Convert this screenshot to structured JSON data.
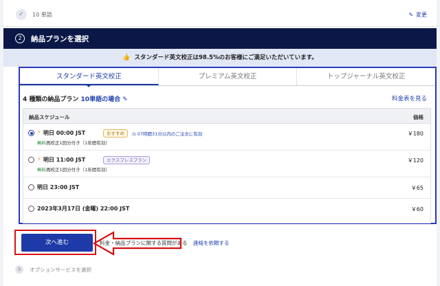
{
  "step1": {
    "text": "10 単語",
    "change_label": "変更"
  },
  "step2": {
    "number": "2",
    "title": "納品プランを選択"
  },
  "banner": {
    "text": "スタンダード英文校正は98.5%のお客様にご満足いただいています。"
  },
  "tabs": [
    {
      "label": "スタンダード英文校正",
      "active": true
    },
    {
      "label": "プレミアム英文校正",
      "active": false
    },
    {
      "label": "トップジャーナル英文校正",
      "active": false
    }
  ],
  "plans": {
    "heading_prefix": "4 種類の納品プラン",
    "heading_highlight": "10単語の場合",
    "price_table_link": "料金表を見る",
    "col_schedule": "納品スケジュール",
    "col_price": "価格",
    "rows": [
      {
        "time": "明日 00:00 JST",
        "badge": "おすすめ",
        "note": "07時間31分以内のご注文に有効",
        "free_label": "無料",
        "sub": "再校正1回分付き（1年間有効）",
        "price": "￥180",
        "selected": true
      },
      {
        "time": "明日 11:00 JST",
        "badge": "エクスプレスプラン",
        "free_label": "無料",
        "sub": "再校正1回分付き（1年間有効）",
        "price": "￥120",
        "selected": false
      },
      {
        "time": "明日 23:00 JST",
        "price": "￥65",
        "selected": false
      },
      {
        "time": "2023年3月17日 (金曜) 22:00 JST",
        "price": "￥60",
        "selected": false
      }
    ]
  },
  "next_button": "次へ進む",
  "inquiry": {
    "text": "料金・納品プランに関する質問がある",
    "link": "連絡を依頼する"
  },
  "step3": {
    "number": "3",
    "title": "オプションサービスを選択"
  },
  "colors": {
    "navy": "#0b1847",
    "accent": "#1d3aa8",
    "highlight_red": "#d41212",
    "outline_blue": "#2838b8"
  }
}
